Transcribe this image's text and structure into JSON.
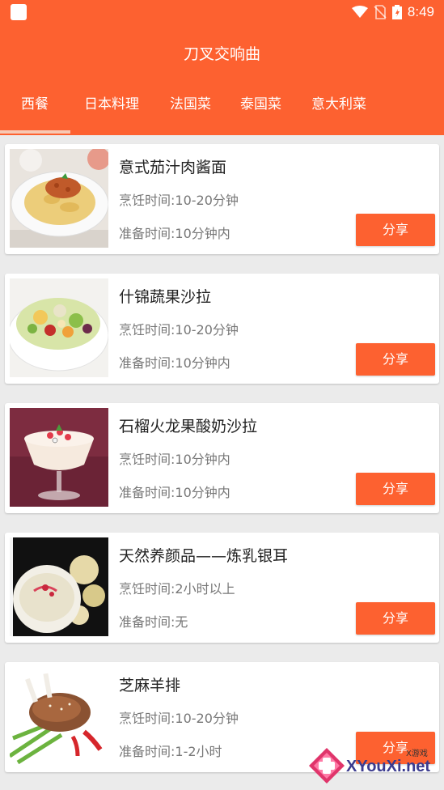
{
  "status_bar": {
    "time": "8:49"
  },
  "app": {
    "title": "刀叉交响曲"
  },
  "tabs": [
    {
      "label": "西餐",
      "active": true
    },
    {
      "label": "日本料理",
      "active": false
    },
    {
      "label": "法国菜",
      "active": false
    },
    {
      "label": "泰国菜",
      "active": false
    },
    {
      "label": "意大利菜",
      "active": false
    }
  ],
  "recipes": [
    {
      "name": "意式茄汁肉酱面",
      "cook_time": "烹饪时间:10-20分钟",
      "prep_time": "准备时间:10分钟内",
      "share_label": "分享"
    },
    {
      "name": "什锦蔬果沙拉",
      "cook_time": "烹饪时间:10-20分钟",
      "prep_time": "准备时间:10分钟内",
      "share_label": "分享"
    },
    {
      "name": "石榴火龙果酸奶沙拉",
      "cook_time": "烹饪时间:10分钟内",
      "prep_time": "准备时间:10分钟内",
      "share_label": "分享"
    },
    {
      "name": "天然养颜品——炼乳银耳",
      "cook_time": "烹饪时间:2小时以上",
      "prep_time": "准备时间:无",
      "share_label": "分享"
    },
    {
      "name": "芝麻羊排",
      "cook_time": "烹饪时间:10-20分钟",
      "prep_time": "准备时间:1-2小时",
      "share_label": "分享"
    }
  ],
  "watermark": {
    "brand": "XYouXi.net",
    "sub": "X游戏"
  },
  "colors": {
    "accent": "#fd6130",
    "background": "#ebebeb",
    "card": "#ffffff"
  }
}
